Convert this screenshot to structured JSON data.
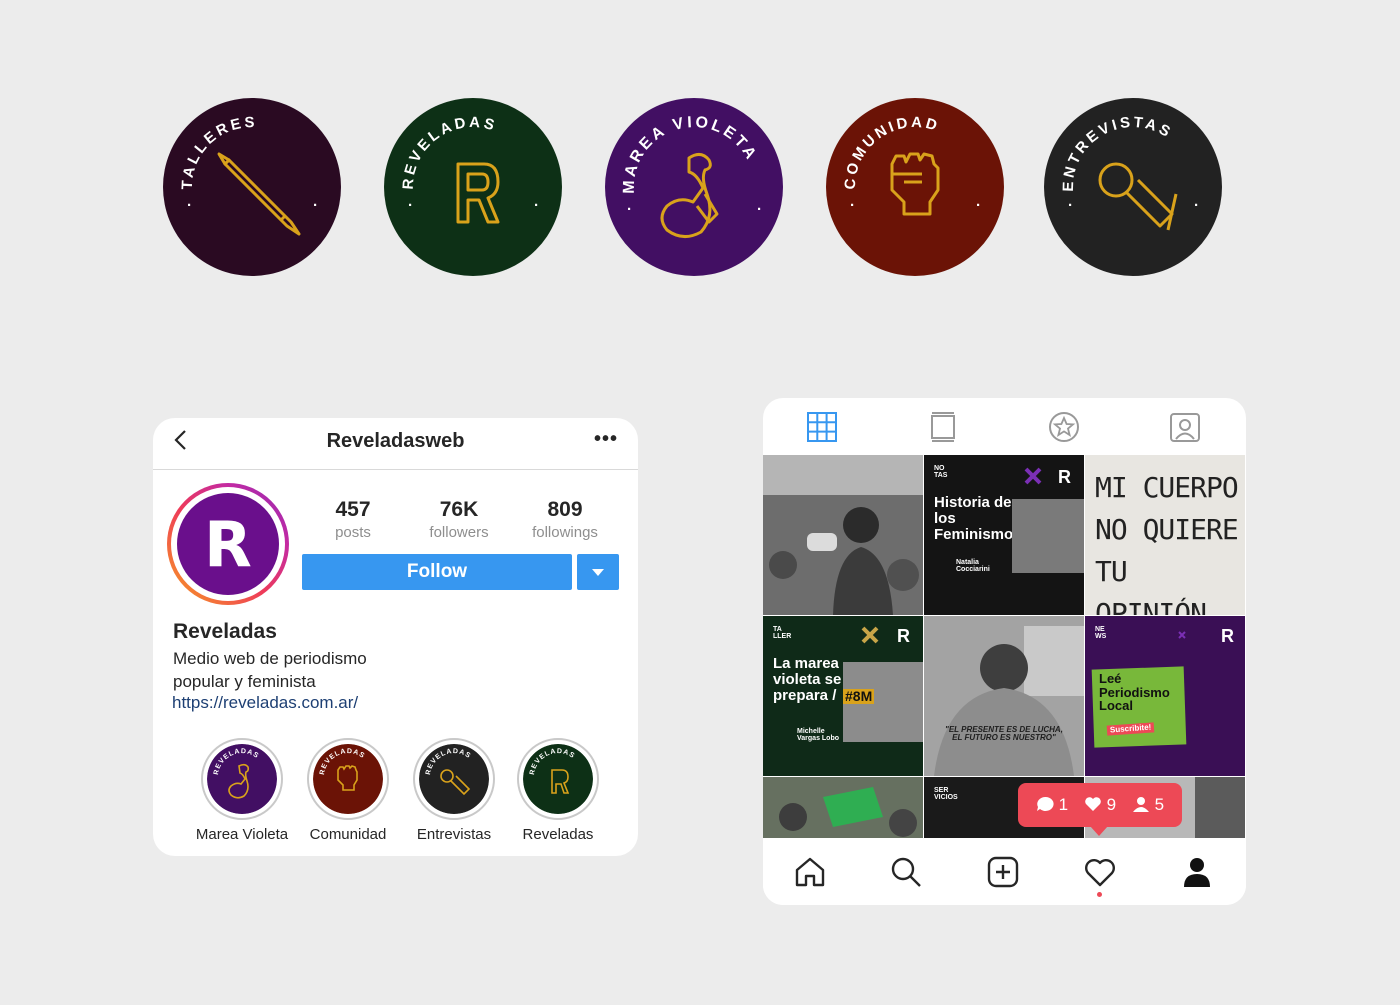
{
  "highlight_badges": [
    {
      "label": "TALLERES",
      "color": "#2a0a22",
      "icon": "pencil-icon"
    },
    {
      "label": "REVELADAS",
      "color": "#0d3016",
      "icon": "r-letter-icon"
    },
    {
      "label": "MAREA VIOLETA",
      "color": "#420f63",
      "icon": "flexed-arm-icon"
    },
    {
      "label": "COMUNIDAD",
      "color": "#6b1306",
      "icon": "raised-fist-icon"
    },
    {
      "label": "ENTREVISTAS",
      "color": "#222222",
      "icon": "microphone-icon"
    }
  ],
  "icon_color": "#d9a21b",
  "profile": {
    "username": "Reveladasweb",
    "more": "•••",
    "avatar_letter": "R",
    "avatar_color": "#6a0f8c",
    "stats": [
      {
        "value": "457",
        "label": "posts"
      },
      {
        "value": "76K",
        "label": "followers"
      },
      {
        "value": "809",
        "label": "followings"
      }
    ],
    "follow_label": "Follow",
    "name": "Reveladas",
    "bio": "Medio web de periodismo popular y feminista",
    "link": "https://reveladas.com.ar/",
    "highlights": [
      {
        "label": "Marea Violeta",
        "ring": "REVELADAS",
        "color": "#420f63",
        "icon": "flexed-arm-icon"
      },
      {
        "label": "Comunidad",
        "ring": "REVELADAS",
        "color": "#6b1306",
        "icon": "raised-fist-icon"
      },
      {
        "label": "Entrevistas",
        "ring": "REVELADAS",
        "color": "#222222",
        "icon": "microphone-icon"
      },
      {
        "label": "Reveladas",
        "ring": "REVELADAS",
        "color": "#0d3016",
        "icon": "r-letter-icon"
      }
    ]
  },
  "feed": {
    "tabs": [
      "grid-icon",
      "feed-icon",
      "star-icon",
      "tagged-icon"
    ],
    "posts": {
      "historia": {
        "tag": "NO TAS",
        "title": "Historia de los Feminismos",
        "author": "Natalia Cocciarini"
      },
      "marea": {
        "tag": "TA LLER",
        "title": "La marea violeta se prepara /",
        "hashtag": "#8M",
        "author": "Michelle Vargas Lobo"
      },
      "cuerpo": {
        "text": "MI CUERPO NO QUIERE TU OPINIÓN"
      },
      "lucha": {
        "text": "\"EL PRESENTE ES DE LUCHA, EL FUTURO ES NUESTRO\""
      },
      "periodismo": {
        "tag": "NE WS",
        "title": "Leé Periodismo Local",
        "cta": "Suscribite!"
      },
      "servicios": {
        "tag": "SER VICIOS"
      }
    },
    "notification": {
      "comments": "1",
      "likes": "9",
      "follows": "5"
    },
    "nav": [
      "home-icon",
      "search-icon",
      "new-post-icon",
      "activity-heart-icon",
      "profile-icon"
    ]
  }
}
